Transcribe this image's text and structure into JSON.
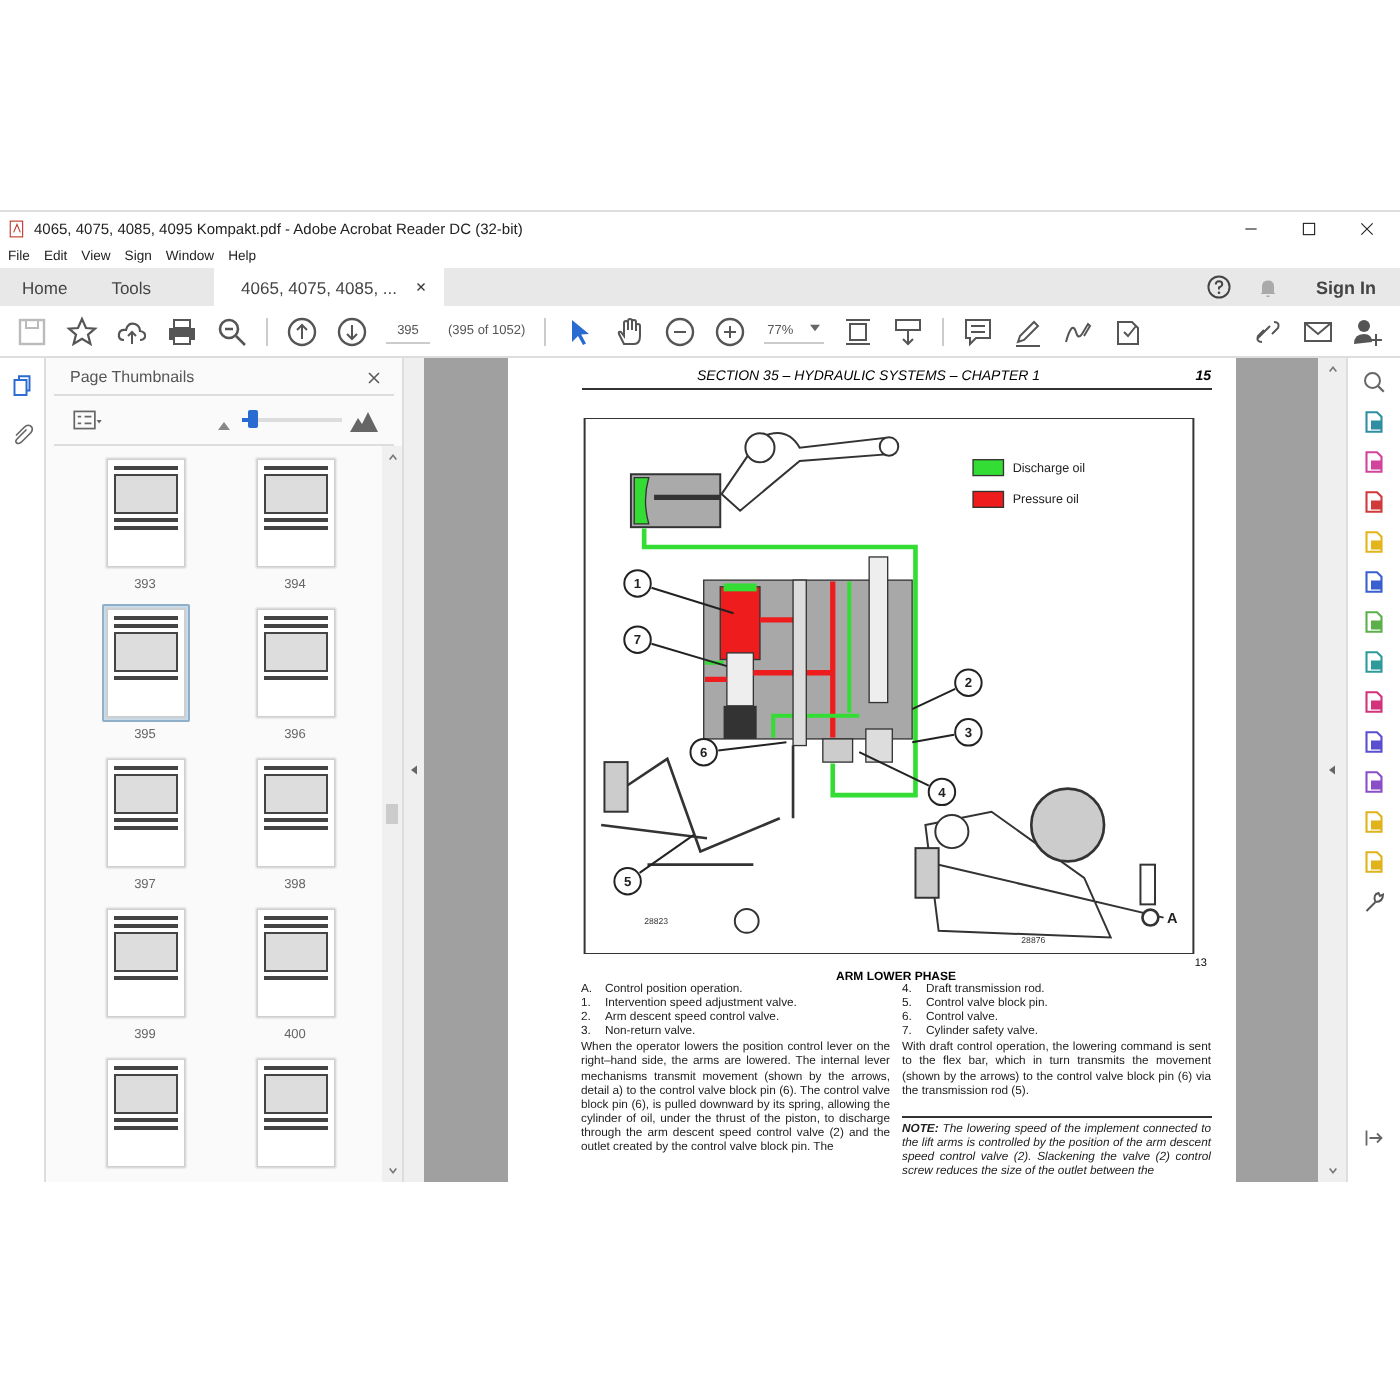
{
  "window": {
    "title": "4065, 4075, 4085, 4095 Kompakt.pdf - Adobe Acrobat Reader DC (32-bit)"
  },
  "menu": [
    "File",
    "Edit",
    "View",
    "Sign",
    "Window",
    "Help"
  ],
  "tabs": [
    {
      "label": "Home",
      "selected": false
    },
    {
      "label": "Tools",
      "selected": false
    },
    {
      "label": "4065, 4075, 4085, ...",
      "selected": true
    }
  ],
  "sign_in": "Sign In",
  "toolbar": {
    "page": "395",
    "page_count": "(395 of 1052)",
    "zoom": "77%"
  },
  "thumbnails_panel": {
    "title": "Page Thumbnails",
    "size_slider": {
      "level": 0.05
    },
    "thumbnails": [
      {
        "label": "393",
        "selected": false
      },
      {
        "label": "394",
        "selected": false
      },
      {
        "label": "395",
        "selected": true
      },
      {
        "label": "396",
        "selected": false
      },
      {
        "label": "397",
        "selected": false
      },
      {
        "label": "398",
        "selected": false
      },
      {
        "label": "399",
        "selected": false
      },
      {
        "label": "400",
        "selected": false
      },
      {
        "selected": false
      },
      {
        "selected": false
      }
    ]
  },
  "document": {
    "header": "SECTION 35 – HYDRAULIC SYSTEMS – CHAPTER 1",
    "page_number": "15",
    "figure": {
      "legend": [
        {
          "label": "Discharge oil",
          "color": "#33dd33"
        },
        {
          "label": "Pressure oil",
          "color": "#ee1c1c"
        }
      ],
      "callouts": [
        "1",
        "2",
        "3",
        "4",
        "5",
        "6",
        "7"
      ],
      "view_label": "A",
      "drawing_codes": [
        "28823",
        "28876"
      ],
      "figure_number": "13"
    },
    "caption": "ARM LOWER PHASE",
    "legend_left": [
      {
        "key": "A.",
        "text": "Control position operation."
      },
      {
        "key": "1.",
        "text": "Intervention speed adjustment valve."
      },
      {
        "key": "2.",
        "text": "Arm descent speed control valve."
      },
      {
        "key": "3.",
        "text": "Non-return valve."
      }
    ],
    "legend_right": [
      {
        "key": "4.",
        "text": "Draft transmission rod."
      },
      {
        "key": "5.",
        "text": "Control valve block pin."
      },
      {
        "key": "6.",
        "text": "Control valve."
      },
      {
        "key": "7.",
        "text": "Cylinder safety valve."
      }
    ],
    "paragraph_left": "When the operator lowers the position control lever on the right–hand side, the arms are lowered. The internal lever mechanisms transmit movement (shown by the arrows, detail a) to the control valve block pin (6). The control valve block pin (6), is pulled downward by its spring, allowing the cylinder of oil, under the thrust of the piston, to discharge through the arm descent speed control valve (2) and the outlet created by the control valve block pin. The",
    "paragraph_right": "With draft control operation, the lowering command is sent to the flex bar, which in turn transmits the movement (shown by the arrows) to the control valve block pin (6) via the transmission rod (5).",
    "note": "**NOTE:** The lowering speed of the implement connected to the lift arms is controlled by the position of the arm descent speed control valve (2). Slackening the valve (2) control screw reduces the size of the outlet between the"
  }
}
